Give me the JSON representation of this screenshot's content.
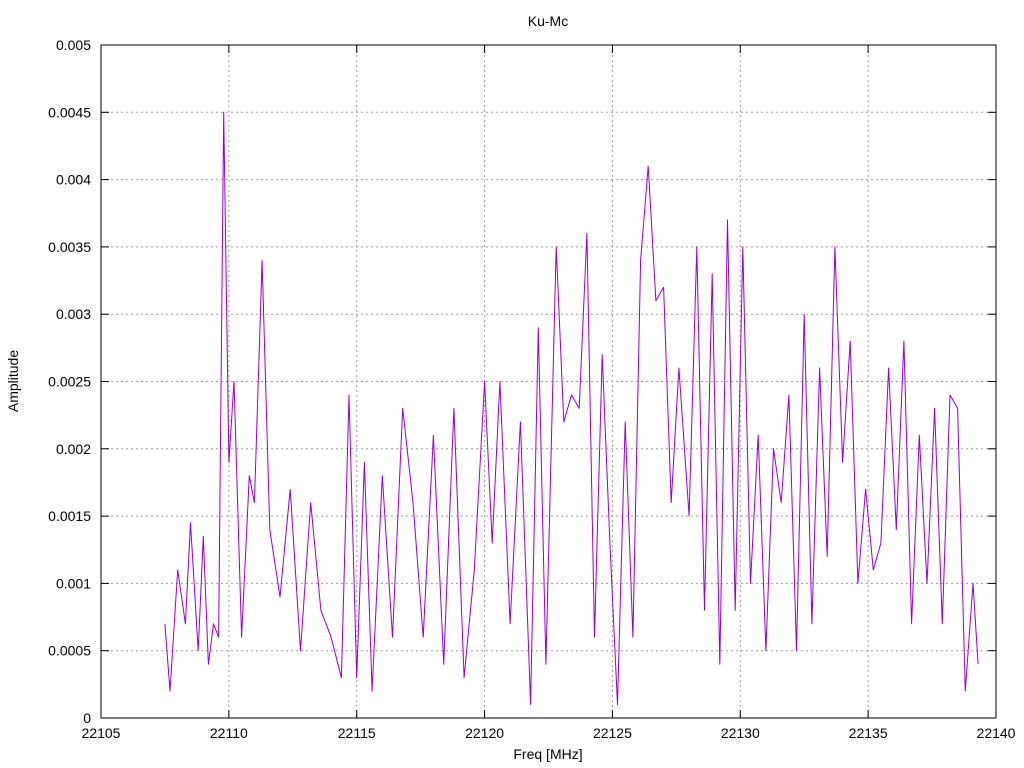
{
  "chart_data": {
    "type": "line",
    "title": "Ku-Mc",
    "xlabel": "Freq [MHz]",
    "ylabel": "Amplitude",
    "xlim": [
      22105,
      22140
    ],
    "ylim": [
      0,
      0.005
    ],
    "x_ticks": [
      22105,
      22110,
      22115,
      22120,
      22125,
      22130,
      22135,
      22140
    ],
    "x_tick_labels": [
      "22105",
      "22110",
      "22115",
      "22120",
      "22125",
      "22130",
      "22135",
      "22140"
    ],
    "y_ticks": [
      0,
      0.0005,
      0.001,
      0.0015,
      0.002,
      0.0025,
      0.003,
      0.0035,
      0.004,
      0.0045,
      0.005
    ],
    "y_tick_labels": [
      "0",
      "0.0005",
      "0.001",
      "0.0015",
      "0.002",
      "0.0025",
      "0.003",
      "0.0035",
      "0.004",
      "0.0045",
      "0.005"
    ],
    "grid": true,
    "series": [
      {
        "color": "#9400d3",
        "x": [
          22107.5,
          22107.7,
          22108.0,
          22108.3,
          22108.5,
          22108.8,
          22109.0,
          22109.2,
          22109.4,
          22109.6,
          22109.8,
          22110.0,
          22110.2,
          22110.5,
          22110.8,
          22111.0,
          22111.3,
          22111.6,
          22112.0,
          22112.4,
          22112.8,
          22113.2,
          22113.6,
          22114.0,
          22114.4,
          22114.7,
          22115.0,
          22115.3,
          22115.6,
          22116.0,
          22116.4,
          22116.8,
          22117.2,
          22117.6,
          22118.0,
          22118.4,
          22118.8,
          22119.2,
          22119.6,
          22120.0,
          22120.3,
          22120.6,
          22121.0,
          22121.4,
          22121.8,
          22122.1,
          22122.4,
          22122.8,
          22123.1,
          22123.4,
          22123.7,
          22124.0,
          22124.3,
          22124.6,
          22124.9,
          22125.2,
          22125.5,
          22125.8,
          22126.1,
          22126.4,
          22126.7,
          22127.0,
          22127.3,
          22127.6,
          22128.0,
          22128.3,
          22128.6,
          22128.9,
          22129.2,
          22129.5,
          22129.8,
          22130.1,
          22130.4,
          22130.7,
          22131.0,
          22131.3,
          22131.6,
          22131.9,
          22132.2,
          22132.5,
          22132.8,
          22133.1,
          22133.4,
          22133.7,
          22134.0,
          22134.3,
          22134.6,
          22134.9,
          22135.2,
          22135.5,
          22135.8,
          22136.1,
          22136.4,
          22136.7,
          22137.0,
          22137.3,
          22137.6,
          22137.9,
          22138.2,
          22138.5,
          22138.8,
          22139.1,
          22139.3
        ],
        "y": [
          0.0007,
          0.0002,
          0.0011,
          0.0007,
          0.00145,
          0.0005,
          0.00135,
          0.0004,
          0.0007,
          0.0006,
          0.0045,
          0.0019,
          0.0025,
          0.0006,
          0.0018,
          0.0016,
          0.0034,
          0.0014,
          0.0009,
          0.0017,
          0.0005,
          0.0016,
          0.0008,
          0.0006,
          0.0003,
          0.0024,
          0.0003,
          0.0019,
          0.0002,
          0.0018,
          0.0006,
          0.0023,
          0.0016,
          0.0006,
          0.0021,
          0.0004,
          0.0023,
          0.0003,
          0.0011,
          0.0025,
          0.0013,
          0.0025,
          0.0007,
          0.0022,
          0.0001,
          0.0029,
          0.0004,
          0.0035,
          0.0022,
          0.0024,
          0.0023,
          0.0036,
          0.0006,
          0.0027,
          0.0013,
          0.0001,
          0.0022,
          0.0006,
          0.0034,
          0.0041,
          0.0031,
          0.0032,
          0.0016,
          0.0026,
          0.0015,
          0.0035,
          0.0008,
          0.0033,
          0.0004,
          0.0037,
          0.0008,
          0.0035,
          0.001,
          0.0021,
          0.0005,
          0.002,
          0.0016,
          0.0024,
          0.0005,
          0.003,
          0.0007,
          0.0026,
          0.0012,
          0.0035,
          0.0019,
          0.0028,
          0.001,
          0.0017,
          0.0011,
          0.0013,
          0.0026,
          0.0014,
          0.0028,
          0.0007,
          0.0021,
          0.001,
          0.0023,
          0.0007,
          0.0024,
          0.0023,
          0.0002,
          0.001,
          0.0004
        ]
      }
    ]
  }
}
